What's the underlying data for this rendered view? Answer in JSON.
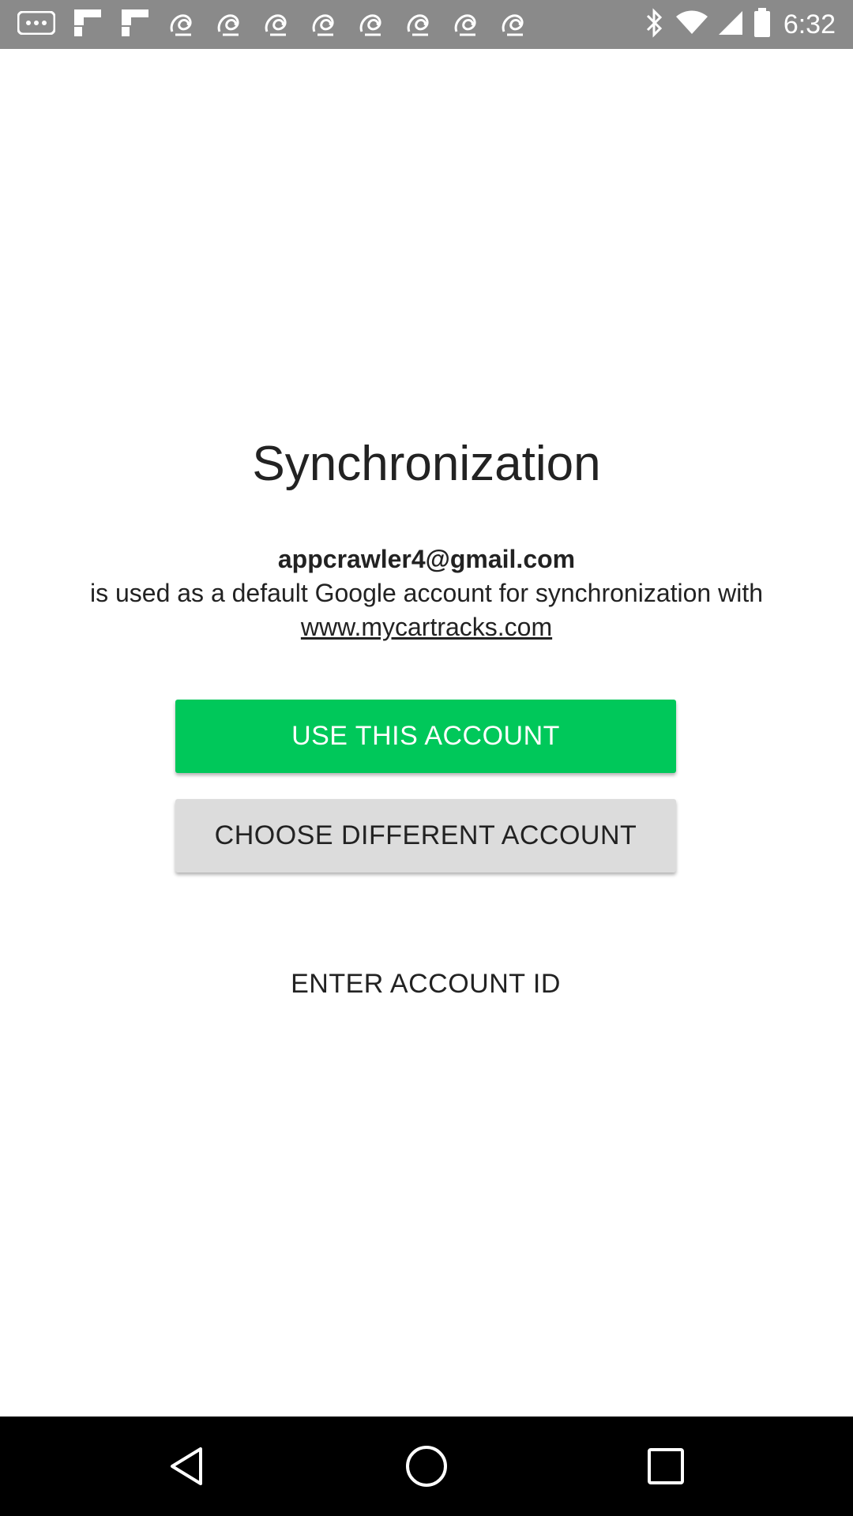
{
  "status_bar": {
    "time": "6:32",
    "icons": [
      "more-icon",
      "flipboard-icon",
      "flipboard-icon",
      "notification-app-icon",
      "notification-app-icon",
      "notification-app-icon",
      "notification-app-icon",
      "notification-app-icon",
      "notification-app-icon",
      "notification-app-icon",
      "notification-app-icon",
      "bluetooth-icon",
      "wifi-icon",
      "cellular-signal-icon",
      "battery-icon"
    ]
  },
  "main": {
    "title": "Synchronization",
    "email": "appcrawler4@gmail.com",
    "message": "is used as a default Google account for synchronization with",
    "link": "www.mycartracks.com",
    "use_account_label": "USE THIS ACCOUNT",
    "choose_account_label": "CHOOSE DIFFERENT ACCOUNT",
    "enter_id_label": "ENTER ACCOUNT ID"
  },
  "colors": {
    "primary_button": "#00c85a",
    "secondary_button": "#dcdcdc",
    "status_bar": "#8a8a8a",
    "nav_bar": "#000000"
  },
  "nav_bar": {
    "icons": [
      "back-icon",
      "home-icon",
      "recents-icon"
    ]
  }
}
